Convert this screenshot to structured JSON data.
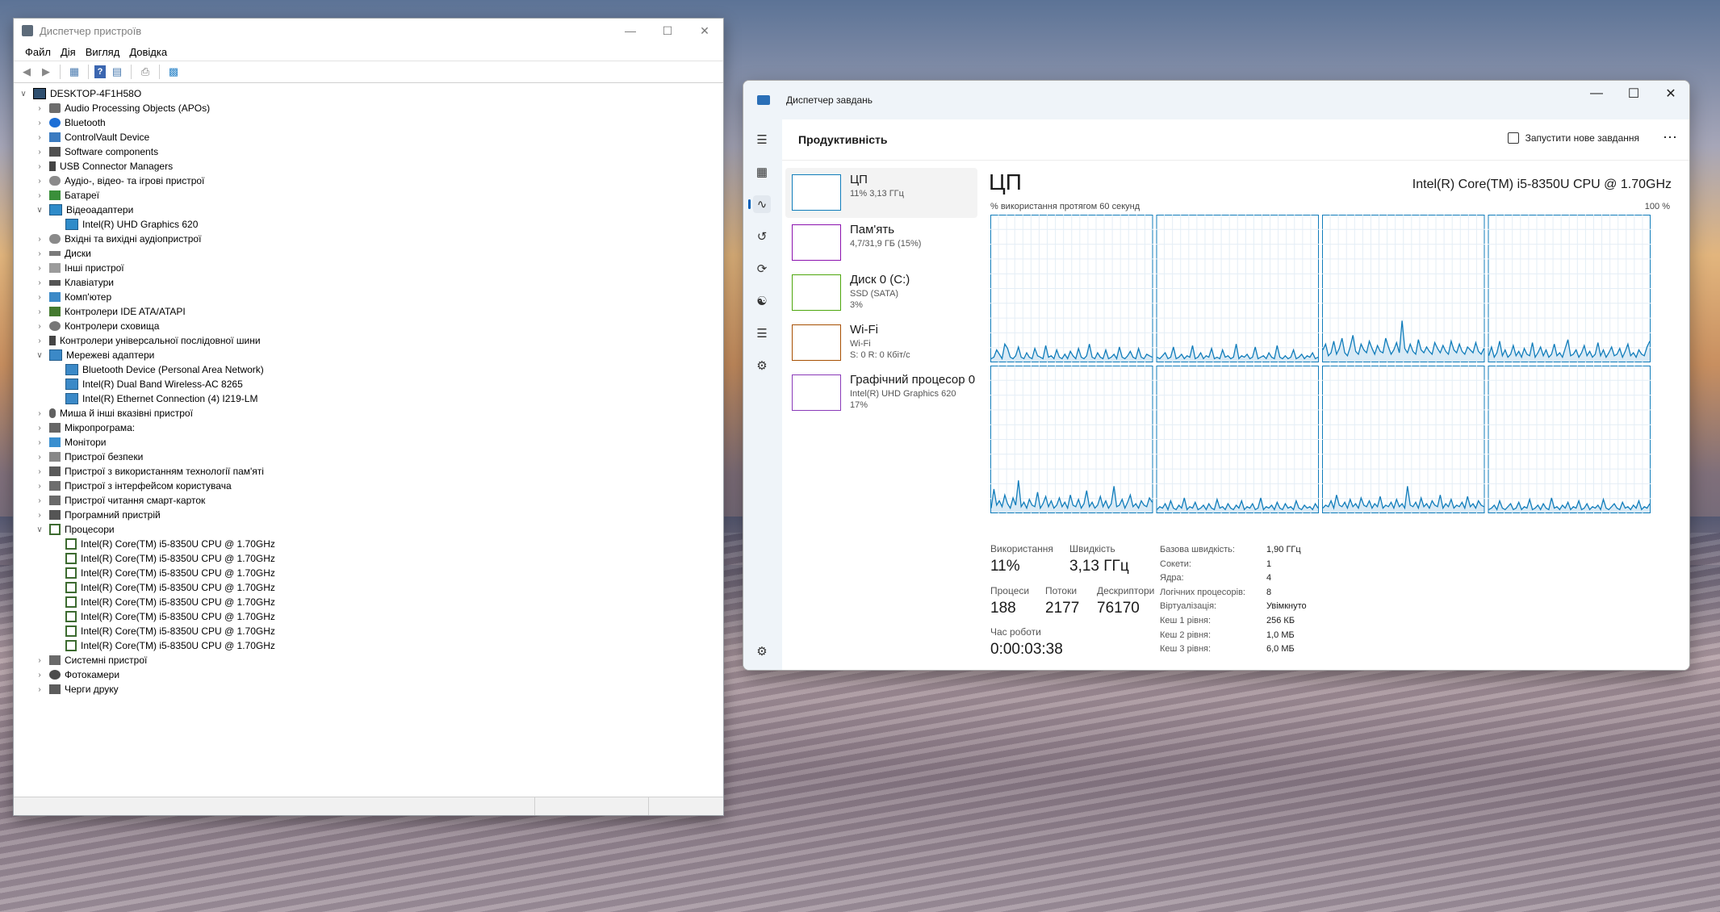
{
  "device_manager": {
    "title": "Диспетчер пристроїв",
    "menu": [
      "Файл",
      "Дія",
      "Вигляд",
      "Довідка"
    ],
    "toolbar_icons": [
      "back-icon",
      "forward-icon",
      "properties-icon",
      "help-icon",
      "view-icon",
      "scan-icon",
      "monitor-icon"
    ],
    "root": "DESKTOP-4F1H58O",
    "tree": [
      {
        "label": "Audio Processing Objects (APOs)",
        "icon": "audio",
        "expanded": false,
        "children": []
      },
      {
        "label": "Bluetooth",
        "icon": "bt",
        "expanded": false,
        "children": []
      },
      {
        "label": "ControlVault Device",
        "icon": "sec",
        "expanded": false,
        "children": []
      },
      {
        "label": "Software components",
        "icon": "comp",
        "expanded": false,
        "children": []
      },
      {
        "label": "USB Connector Managers",
        "icon": "usb",
        "expanded": false,
        "children": []
      },
      {
        "label": "Аудіо-, відео- та ігрові пристрої",
        "icon": "sound",
        "expanded": false,
        "children": []
      },
      {
        "label": "Батареї",
        "icon": "batt",
        "expanded": false,
        "children": []
      },
      {
        "label": "Відеоадаптери",
        "icon": "disp",
        "expanded": true,
        "children": [
          "Intel(R) UHD Graphics 620"
        ]
      },
      {
        "label": "Вхідні та вихідні аудіопристрої",
        "icon": "sound",
        "expanded": false,
        "children": []
      },
      {
        "label": "Диски",
        "icon": "disk",
        "expanded": false,
        "children": []
      },
      {
        "label": "Інші пристрої",
        "icon": "misc",
        "expanded": false,
        "children": []
      },
      {
        "label": "Клавіатури",
        "icon": "kbd",
        "expanded": false,
        "children": []
      },
      {
        "label": "Комп'ютер",
        "icon": "pc",
        "expanded": false,
        "children": []
      },
      {
        "label": "Контролери IDE ATA/ATAPI",
        "icon": "ide",
        "expanded": false,
        "children": []
      },
      {
        "label": "Контролери сховища",
        "icon": "stor",
        "expanded": false,
        "children": []
      },
      {
        "label": "Контролери універсальної послідовної шини",
        "icon": "bus",
        "expanded": false,
        "children": []
      },
      {
        "label": "Мережеві адаптери",
        "icon": "net",
        "expanded": true,
        "children": [
          "Bluetooth Device (Personal Area Network)",
          "Intel(R) Dual Band Wireless-AC 8265",
          "Intel(R) Ethernet Connection (4) I219-LM"
        ]
      },
      {
        "label": "Миша й інші вказівні пристрої",
        "icon": "mouse",
        "expanded": false,
        "children": []
      },
      {
        "label": "Мікропрограма:",
        "icon": "fw",
        "expanded": false,
        "children": []
      },
      {
        "label": "Монітори",
        "icon": "mon",
        "expanded": false,
        "children": []
      },
      {
        "label": "Пристрої безпеки",
        "icon": "secdev",
        "expanded": false,
        "children": []
      },
      {
        "label": "Пристрої з використанням технології пам'яті",
        "icon": "mem",
        "expanded": false,
        "children": []
      },
      {
        "label": "Пристрої з інтерфейсом користувача",
        "icon": "hid",
        "expanded": false,
        "children": []
      },
      {
        "label": "Пристрої читання смарт-карток",
        "icon": "smart",
        "expanded": false,
        "children": []
      },
      {
        "label": "Програмний пристрій",
        "icon": "soft",
        "expanded": false,
        "children": []
      },
      {
        "label": "Процесори",
        "icon": "cpu",
        "expanded": true,
        "children": [
          "Intel(R) Core(TM) i5-8350U CPU @ 1.70GHz",
          "Intel(R) Core(TM) i5-8350U CPU @ 1.70GHz",
          "Intel(R) Core(TM) i5-8350U CPU @ 1.70GHz",
          "Intel(R) Core(TM) i5-8350U CPU @ 1.70GHz",
          "Intel(R) Core(TM) i5-8350U CPU @ 1.70GHz",
          "Intel(R) Core(TM) i5-8350U CPU @ 1.70GHz",
          "Intel(R) Core(TM) i5-8350U CPU @ 1.70GHz",
          "Intel(R) Core(TM) i5-8350U CPU @ 1.70GHz"
        ]
      },
      {
        "label": "Системні пристрої",
        "icon": "sys",
        "expanded": false,
        "children": []
      },
      {
        "label": "Фотокамери",
        "icon": "cam",
        "expanded": false,
        "children": []
      },
      {
        "label": "Черги друку",
        "icon": "prn",
        "expanded": false,
        "children": []
      }
    ]
  },
  "task_manager": {
    "title": "Диспетчер завдань",
    "section_title": "Продуктивність",
    "run_task_label": "Запустити нове завдання",
    "more_label": "⋯",
    "nav_icons": [
      "hamburger-icon",
      "processes-icon",
      "performance-icon",
      "app-history-icon",
      "startup-icon",
      "users-icon",
      "details-icon",
      "services-icon",
      "settings-icon"
    ],
    "perf_items": [
      {
        "name": "ЦП",
        "line1": "11%  3,13 ГГц",
        "line2": "",
        "color": "#117dbb",
        "selected": true
      },
      {
        "name": "Пам'ять",
        "line1": "4,7/31,9 ГБ (15%)",
        "line2": "",
        "color": "#8b12ae",
        "selected": false
      },
      {
        "name": "Диск 0 (C:)",
        "line1": "SSD (SATA)",
        "line2": "3%",
        "color": "#4da60c",
        "selected": false
      },
      {
        "name": "Wi-Fi",
        "line1": "Wi-Fi",
        "line2": "S: 0  R: 0 Кбіт/с",
        "color": "#a74f01",
        "selected": false
      },
      {
        "name": "Графічний процесор 0",
        "line1": "Intel(R) UHD Graphics 620",
        "line2": "17%",
        "color": "#8a3ab9",
        "selected": false
      }
    ],
    "cpu": {
      "title": "ЦП",
      "model": "Intel(R) Core(TM) i5-8350U CPU @ 1.70GHz",
      "util_label": "% використання протягом 60 секунд",
      "max_label": "100 %",
      "stats": {
        "utilization_label": "Використання",
        "utilization_value": "11%",
        "speed_label": "Швидкість",
        "speed_value": "3,13 ГГц",
        "processes_label": "Процеси",
        "processes_value": "188",
        "threads_label": "Потоки",
        "threads_value": "2177",
        "handles_label": "Дескриптори",
        "handles_value": "76170",
        "uptime_label": "Час роботи",
        "uptime_value": "0:00:03:38"
      },
      "details": [
        {
          "k": "Базова швидкість:",
          "v": "1,90 ГГц"
        },
        {
          "k": "Сокети:",
          "v": "1"
        },
        {
          "k": "Ядра:",
          "v": "4"
        },
        {
          "k": "Логічних процесорів:",
          "v": "8"
        },
        {
          "k": "Віртуалізація:",
          "v": "Увімкнуто"
        },
        {
          "k": "Кеш 1 рівня:",
          "v": "256 КБ"
        },
        {
          "k": "Кеш 2 рівня:",
          "v": "1,0 МБ"
        },
        {
          "k": "Кеш 3 рівня:",
          "v": "6,0 МБ"
        }
      ],
      "cores": [
        [
          2,
          3,
          8,
          5,
          2,
          12,
          9,
          3,
          2,
          4,
          10,
          3,
          2,
          6,
          3,
          2,
          9,
          4,
          3,
          2,
          11,
          3,
          4,
          2,
          8,
          3,
          2,
          5,
          2,
          7,
          4,
          2,
          9,
          3,
          2,
          4,
          12,
          3,
          2,
          6,
          3,
          2,
          8,
          2,
          3,
          5,
          2,
          10,
          3,
          2,
          4,
          7,
          3,
          2,
          9,
          3,
          2,
          5,
          4,
          3
        ],
        [
          3,
          2,
          4,
          6,
          2,
          3,
          10,
          2,
          3,
          5,
          2,
          4,
          3,
          11,
          2,
          3,
          6,
          2,
          4,
          3,
          9,
          2,
          3,
          2,
          8,
          3,
          4,
          2,
          3,
          12,
          2,
          4,
          3,
          5,
          2,
          3,
          10,
          2,
          3,
          4,
          2,
          6,
          3,
          2,
          11,
          3,
          2,
          4,
          2,
          3,
          8,
          2,
          3,
          5,
          2,
          4,
          3,
          6,
          2,
          3
        ],
        [
          8,
          12,
          4,
          6,
          14,
          5,
          9,
          16,
          6,
          4,
          10,
          18,
          7,
          5,
          12,
          8,
          6,
          14,
          9,
          5,
          11,
          7,
          6,
          16,
          10,
          5,
          8,
          13,
          6,
          28,
          9,
          6,
          12,
          7,
          5,
          15,
          8,
          6,
          10,
          7,
          5,
          13,
          9,
          6,
          11,
          7,
          5,
          14,
          8,
          6,
          12,
          7,
          5,
          10,
          8,
          6,
          13,
          7,
          5,
          9
        ],
        [
          4,
          10,
          3,
          6,
          14,
          4,
          8,
          3,
          5,
          11,
          4,
          7,
          3,
          9,
          5,
          4,
          13,
          3,
          6,
          10,
          4,
          8,
          3,
          5,
          12,
          4,
          6,
          3,
          9,
          15,
          4,
          5,
          8,
          3,
          6,
          11,
          4,
          7,
          3,
          5,
          13,
          4,
          8,
          3,
          6,
          10,
          4,
          5,
          9,
          3,
          7,
          12,
          4,
          6,
          3,
          8,
          5,
          4,
          10,
          14
        ],
        [
          3,
          16,
          5,
          8,
          4,
          12,
          6,
          3,
          10,
          5,
          22,
          4,
          7,
          3,
          9,
          5,
          4,
          14,
          3,
          6,
          11,
          4,
          8,
          3,
          5,
          10,
          4,
          7,
          3,
          12,
          5,
          4,
          9,
          3,
          6,
          15,
          4,
          7,
          3,
          5,
          11,
          4,
          8,
          3,
          6,
          18,
          4,
          5,
          9,
          3,
          7,
          12,
          4,
          6,
          3,
          8,
          5,
          4,
          10,
          7
        ],
        [
          2,
          4,
          3,
          6,
          2,
          8,
          3,
          2,
          5,
          3,
          10,
          2,
          4,
          3,
          7,
          2,
          3,
          5,
          2,
          6,
          3,
          2,
          9,
          3,
          4,
          2,
          6,
          3,
          2,
          5,
          3,
          8,
          2,
          4,
          3,
          6,
          2,
          3,
          10,
          2,
          4,
          3,
          5,
          2,
          7,
          3,
          2,
          6,
          3,
          4,
          2,
          8,
          3,
          2,
          5,
          3,
          4,
          2,
          6,
          3
        ],
        [
          3,
          5,
          4,
          8,
          3,
          12,
          5,
          4,
          7,
          3,
          9,
          4,
          6,
          3,
          10,
          5,
          4,
          8,
          3,
          6,
          4,
          11,
          3,
          5,
          4,
          7,
          3,
          9,
          4,
          6,
          3,
          18,
          5,
          4,
          7,
          3,
          10,
          4,
          6,
          3,
          8,
          5,
          4,
          12,
          3,
          6,
          4,
          9,
          3,
          5,
          4,
          7,
          3,
          11,
          4,
          6,
          3,
          8,
          5,
          4
        ],
        [
          2,
          3,
          5,
          2,
          8,
          3,
          2,
          4,
          6,
          2,
          3,
          7,
          2,
          4,
          3,
          9,
          2,
          3,
          5,
          2,
          6,
          3,
          2,
          10,
          3,
          4,
          2,
          5,
          3,
          7,
          2,
          4,
          3,
          8,
          2,
          3,
          6,
          2,
          4,
          3,
          5,
          2,
          9,
          3,
          2,
          4,
          6,
          3,
          2,
          7,
          3,
          4,
          2,
          5,
          3,
          8,
          2,
          4,
          3,
          6
        ]
      ]
    }
  }
}
